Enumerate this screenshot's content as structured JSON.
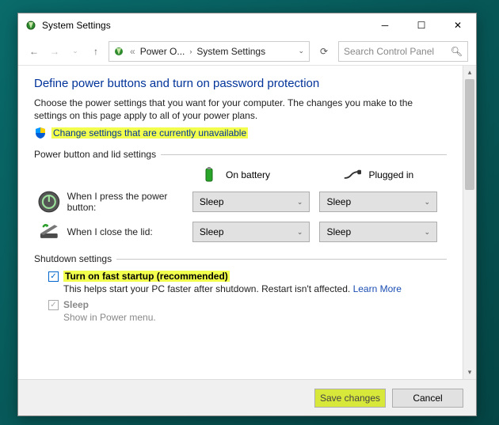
{
  "titlebar": {
    "title": "System Settings"
  },
  "nav": {
    "crumb1": "Power O...",
    "crumb2": "System Settings",
    "search_placeholder": "Search Control Panel"
  },
  "heading": "Define power buttons and turn on password protection",
  "intro": "Choose the power settings that you want for your computer. The changes you make to the settings on this page apply to all of your power plans.",
  "change_link": "Change settings that are currently unavailable",
  "group1": {
    "title": "Power button and lid settings",
    "col_battery": "On battery",
    "col_plugged": "Plugged in",
    "row1_label": "When I press the power button:",
    "row2_label": "When I close the lid:",
    "sel_value": "Sleep"
  },
  "group2": {
    "title": "Shutdown settings",
    "opt1_label": "Turn on fast startup (recommended)",
    "opt1_desc_a": "This helps start your PC faster after shutdown. Restart isn't affected. ",
    "opt1_learn": "Learn More",
    "opt2_label": "Sleep",
    "opt2_desc": "Show in Power menu."
  },
  "footer": {
    "save": "Save changes",
    "cancel": "Cancel"
  }
}
